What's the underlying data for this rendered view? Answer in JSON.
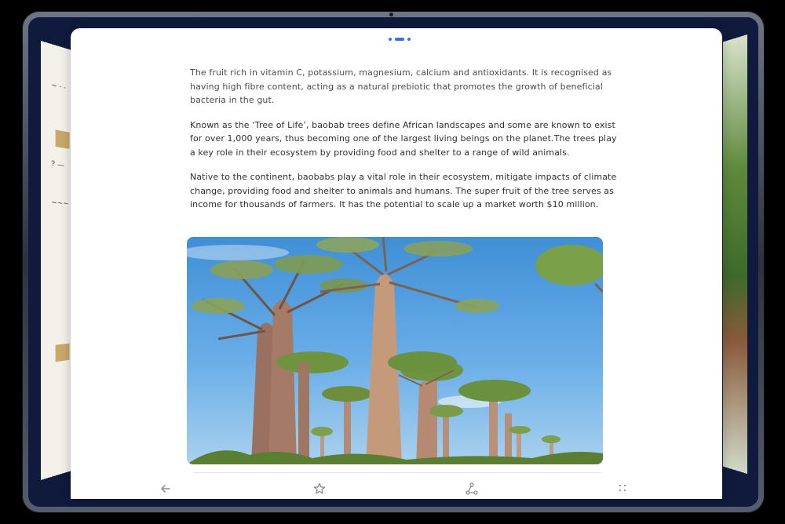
{
  "article": {
    "paragraphs": [
      "The fruit rich in vitamin C, potassium, magnesium, calcium and antioxidants. It is recognised as having high fibre content, acting as a natural prebiotic that promotes the growth of beneficial bacteria in the gut.",
      "Known as the ‘Tree of Life’, baobab trees define African landscapes and some are known to exist for over 1,000 years, thus becoming one of the largest living beings on the planet.The trees play a key role in their ecosystem by providing food and shelter to a range of wild animals.",
      "Native to the continent, baobabs play a vital role in their ecosystem, mitigate impacts of climate change, providing food and shelter to animals and humans. The super fruit of the tree serves as income for thousands of farmers. It has the potential to scale up a market worth $10 million."
    ],
    "image_subject": "baobab trees against blue sky"
  },
  "toolbar": {
    "back_icon": "arrow-left-icon",
    "favorite_icon": "star-icon",
    "share_icon": "share-icon",
    "more_icon": "grid-dots-icon"
  },
  "colors": {
    "accent": "#3d6fe0",
    "text": "#4c4c4c",
    "sky": "#4f9be0",
    "screen_bg": "#0f1a3c"
  }
}
